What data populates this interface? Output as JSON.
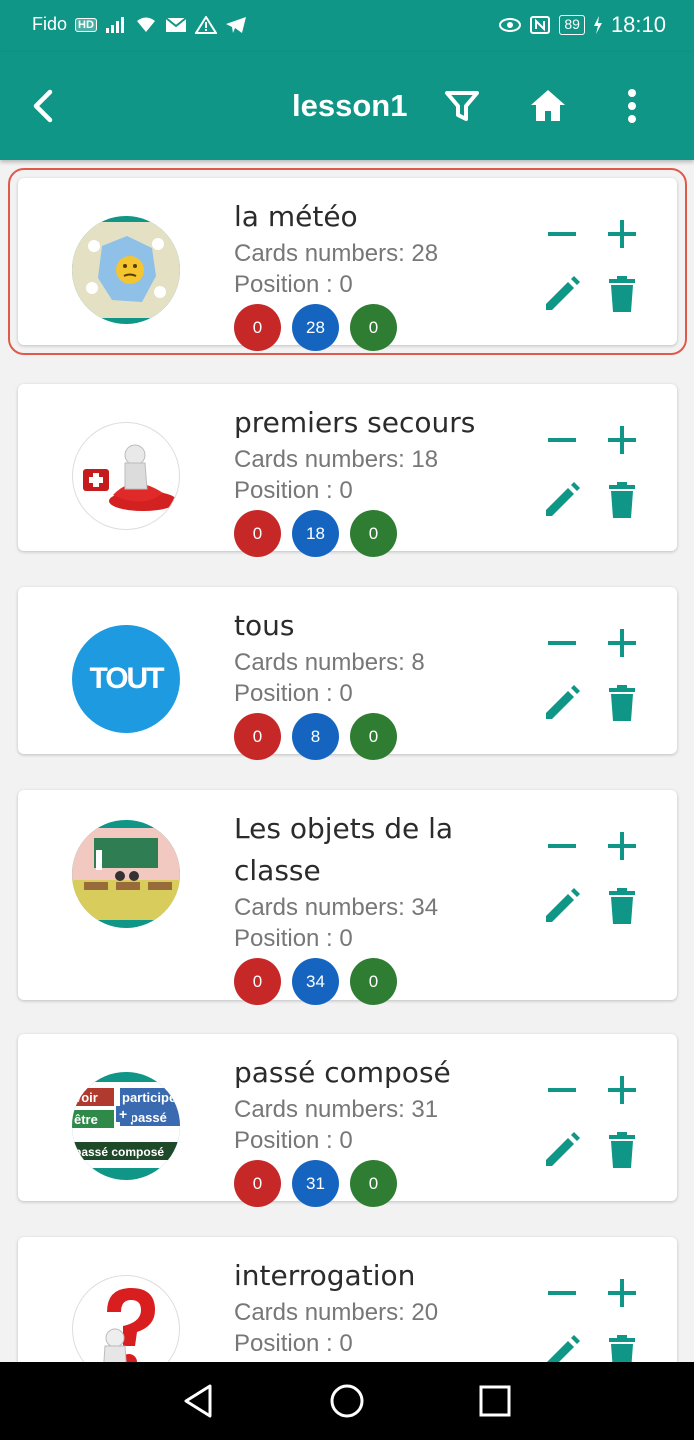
{
  "status_bar": {
    "carrier": "Fido",
    "hd_badge": "HD",
    "battery": "89",
    "time": "18:10",
    "icons": [
      "signal-icon",
      "wifi-icon",
      "mail-icon",
      "warning-icon",
      "telegram-icon",
      "eye-icon",
      "nfc-icon",
      "battery-icon",
      "charging-icon"
    ]
  },
  "app_bar": {
    "title": "lesson1",
    "back_icon": "back-arrow-icon",
    "actions": [
      "filter-icon",
      "home-icon",
      "more-vert-icon"
    ]
  },
  "colors": {
    "primary": "#0f9686",
    "counter_red": "#c62828",
    "counter_blue": "#1565c0",
    "counter_green": "#2e7d32",
    "selection_border": "#e05a4a"
  },
  "lessons": [
    {
      "name": "la météo",
      "cards": "Cards numbers: 28",
      "position": "Position : 0",
      "red": "0",
      "blue": "28",
      "green": "0",
      "thumb_text": "",
      "selected": true
    },
    {
      "name": "premiers secours",
      "cards": "Cards numbers: 18",
      "position": "Position : 0",
      "red": "0",
      "blue": "18",
      "green": "0",
      "thumb_text": ""
    },
    {
      "name": "tous",
      "cards": "Cards numbers: 8",
      "position": "Position : 0",
      "red": "0",
      "blue": "8",
      "green": "0",
      "thumb_text": "TOUT"
    },
    {
      "name": "Les objets de la classe",
      "cards": "Cards numbers: 34",
      "position": "Position : 0",
      "red": "0",
      "blue": "34",
      "green": "0",
      "thumb_text": ""
    },
    {
      "name": "passé composé",
      "cards": "Cards numbers: 31",
      "position": "Position : 0",
      "red": "0",
      "blue": "31",
      "green": "0",
      "thumb_text": ""
    },
    {
      "name": "interrogation",
      "cards": "Cards numbers: 20",
      "position": "Position : 0",
      "red": "",
      "blue": "",
      "green": "",
      "thumb_text": ""
    }
  ],
  "thumb_labels": {
    "passe_compose": [
      "voir",
      "participe",
      "être",
      "passé",
      "passé composé"
    ]
  }
}
